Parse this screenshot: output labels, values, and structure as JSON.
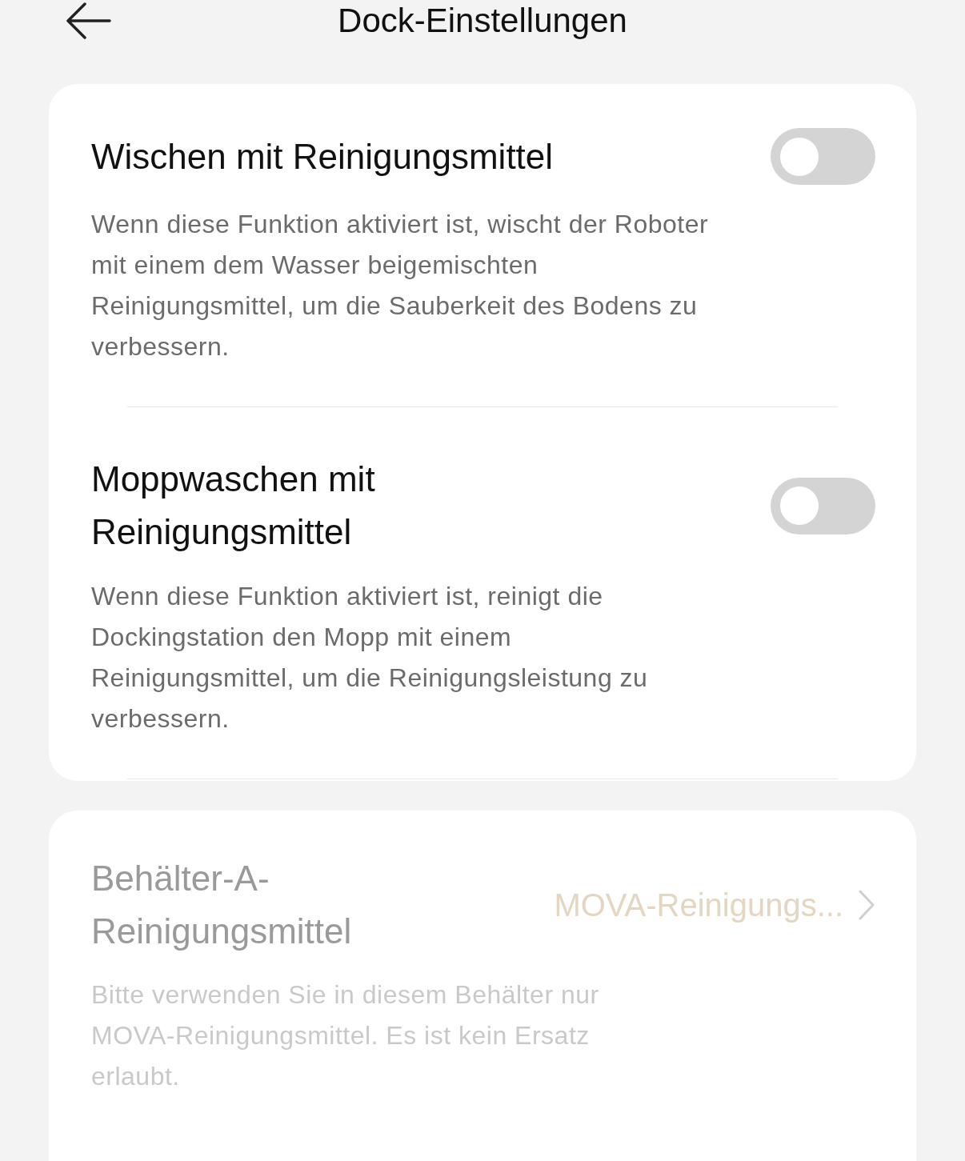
{
  "header": {
    "title": "Dock-Einstellungen"
  },
  "cards": [
    {
      "items": [
        {
          "kind": "toggle",
          "title": "Wischen mit Reinigungsmittel",
          "on": false,
          "description": "Wenn diese Funktion aktiviert ist, wischt der Roboter mit einem dem Wasser beigemischten Reinigungsmittel, um die Sauberkeit des Bodens zu verbessern."
        },
        {
          "kind": "toggle",
          "title": "Moppwaschen mit Reinigungsmittel",
          "on": false,
          "description": "Wenn diese Funktion aktiviert ist, reinigt die Dockingstation den Mopp mit einem Reinigungsmittel, um die Reinigungsleistung zu verbessern."
        }
      ]
    },
    {
      "items": [
        {
          "kind": "link",
          "title": "Behälter-A-Reinigungsmittel",
          "value": "MOVA-Reinigungs...",
          "disabled": true,
          "description": "Bitte verwenden Sie in diesem Behälter nur MOVA-Reinigungsmittel. Es ist kein Ersatz erlaubt."
        }
      ]
    }
  ]
}
